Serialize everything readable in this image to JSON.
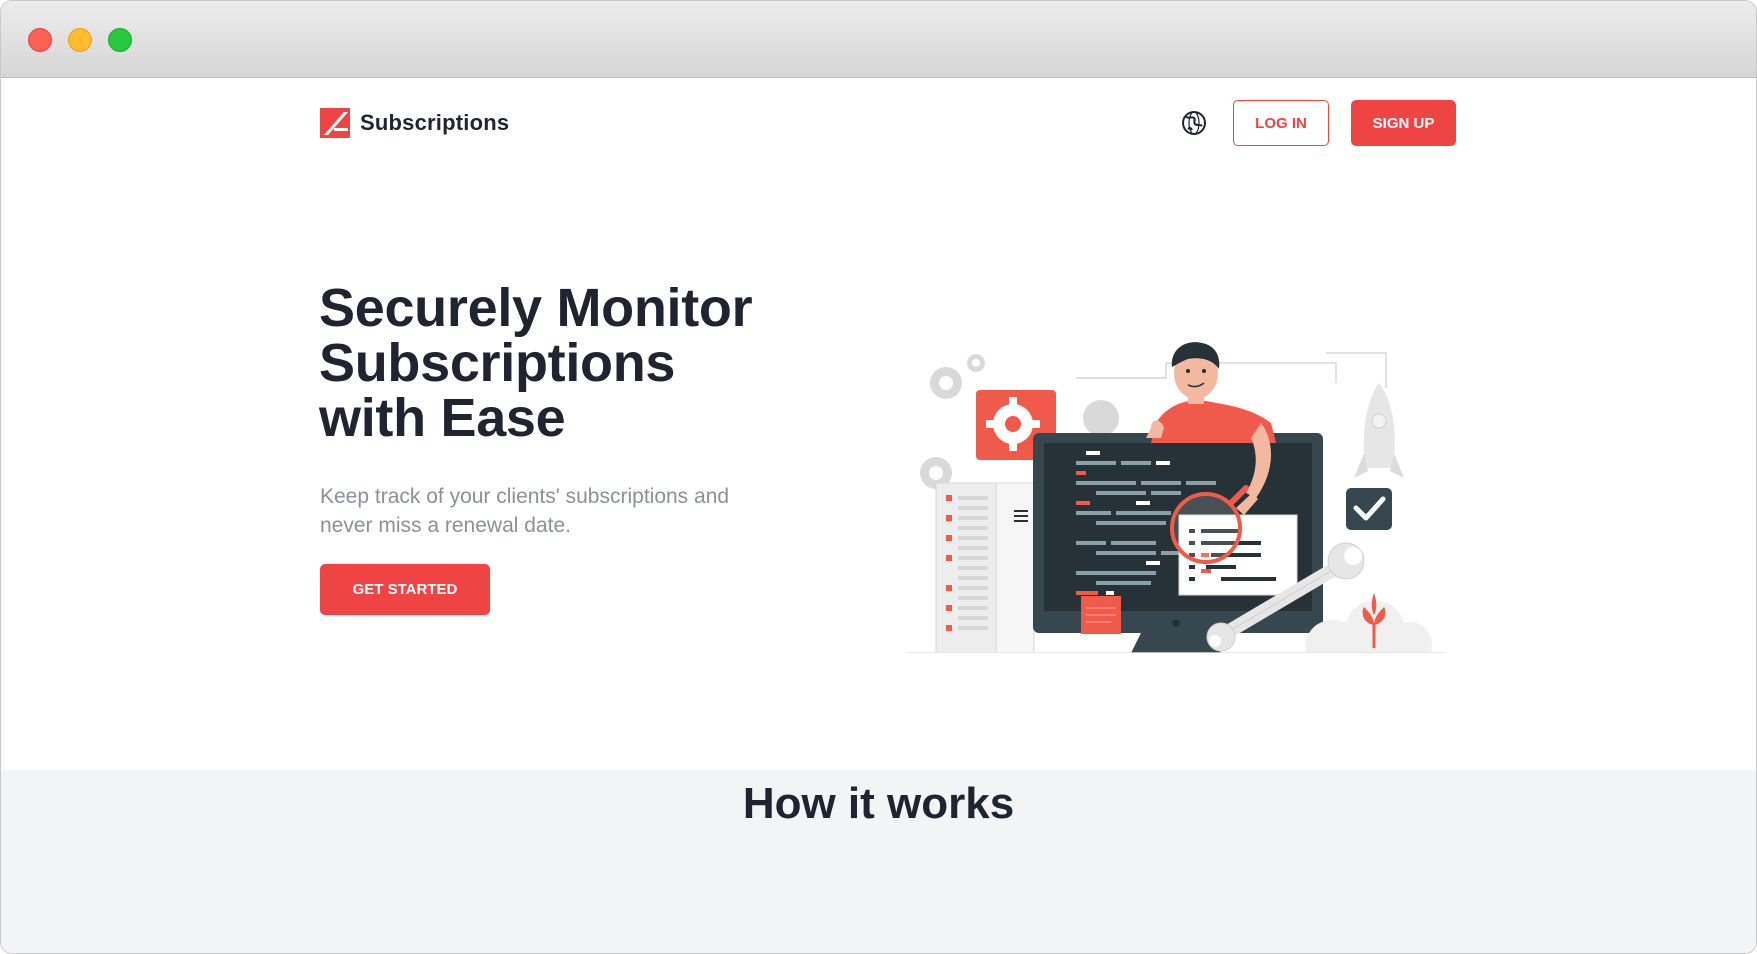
{
  "brand": {
    "name": "Subscriptions"
  },
  "nav": {
    "login_label": "LOG IN",
    "signup_label": "SIGN UP",
    "language_icon": "globe-icon"
  },
  "hero": {
    "title_line1": "Securely Monitor",
    "title_line2": "Subscriptions",
    "title_line3": "with Ease",
    "subtitle": "Keep track of your clients' subscriptions and never miss a renewal date.",
    "cta_label": "GET STARTED"
  },
  "how_it_works": {
    "title": "How it works"
  },
  "colors": {
    "accent": "#ef4444",
    "text": "#1f2430",
    "muted": "#8c909a",
    "dark_screen": "#263238",
    "section_bg": "#f3f4f6"
  }
}
